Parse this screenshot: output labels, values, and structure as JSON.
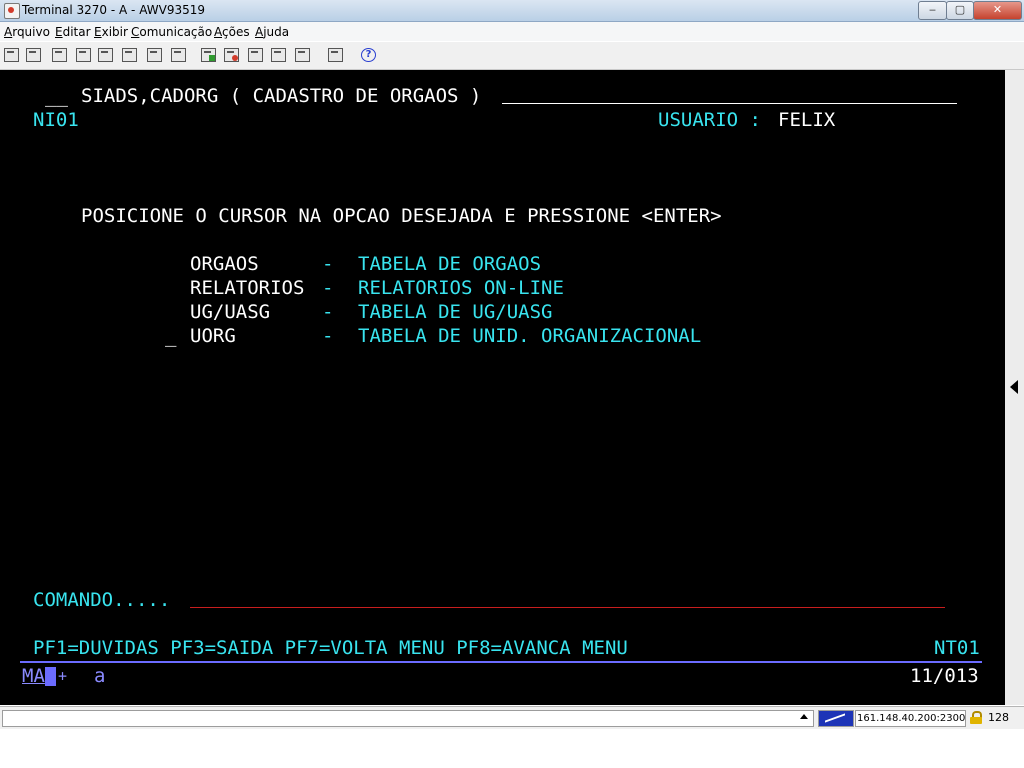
{
  "window": {
    "title": "Terminal 3270 - A - AWV93519",
    "controls": {
      "minimize": "‒",
      "maximize": "▢",
      "close": "✕"
    }
  },
  "menu": [
    "Arquivo",
    "Editar",
    "Exibir",
    "Comunicação",
    "Ações",
    "Ajuda"
  ],
  "toolbar": {
    "icons": [
      "print-icon",
      "print-screen-icon",
      "print-setup-icon",
      "copy-icon",
      "paste-icon",
      "copy-append-icon",
      "cut-icon",
      "keypad-icon",
      "send-icon",
      "receive-icon",
      "macro-icon",
      "record-icon",
      "config-icon",
      "run-icon",
      "help-icon"
    ],
    "help_glyph": "?"
  },
  "terminal": {
    "header_prefix": "__",
    "header_title": "SIADS,CADORG ( CADASTRO DE ORGAOS )",
    "screen_id": "NI01",
    "user_label": "USUARIO :",
    "user_name": "FELIX",
    "instruction": "POSICIONE O CURSOR NA OPCAO DESEJADA E PRESSIONE <ENTER>",
    "options": [
      {
        "code": "ORGAOS",
        "sep": "-",
        "desc": "TABELA DE ORGAOS"
      },
      {
        "code": "RELATORIOS",
        "sep": "-",
        "desc": "RELATORIOS ON-LINE"
      },
      {
        "code": "UG/UASG",
        "sep": "-",
        "desc": "TABELA DE UG/UASG"
      },
      {
        "code": "UORG",
        "sep": "-",
        "desc": "TABELA DE UNID. ORGANIZACIONAL"
      }
    ],
    "cursor_marker": "_",
    "command_label": "COMANDO.....",
    "function_keys": "PF1=DUVIDAS PF3=SAIDA PF7=VOLTA MENU PF8=AVANCA MENU",
    "screen_code": "NT01",
    "oia": {
      "ma": "MA",
      "plus": "+",
      "a": "a",
      "cursor_pos": "11/013"
    }
  },
  "status": {
    "address": "161.148.40.200:23000",
    "encryption_bits": "128"
  },
  "colors": {
    "terminal_bg": "#000000",
    "protected_text": "#ffffff",
    "field_text": "#39e4ef",
    "command_line": "#c81e1e",
    "oia_text": "#8a8aff"
  }
}
